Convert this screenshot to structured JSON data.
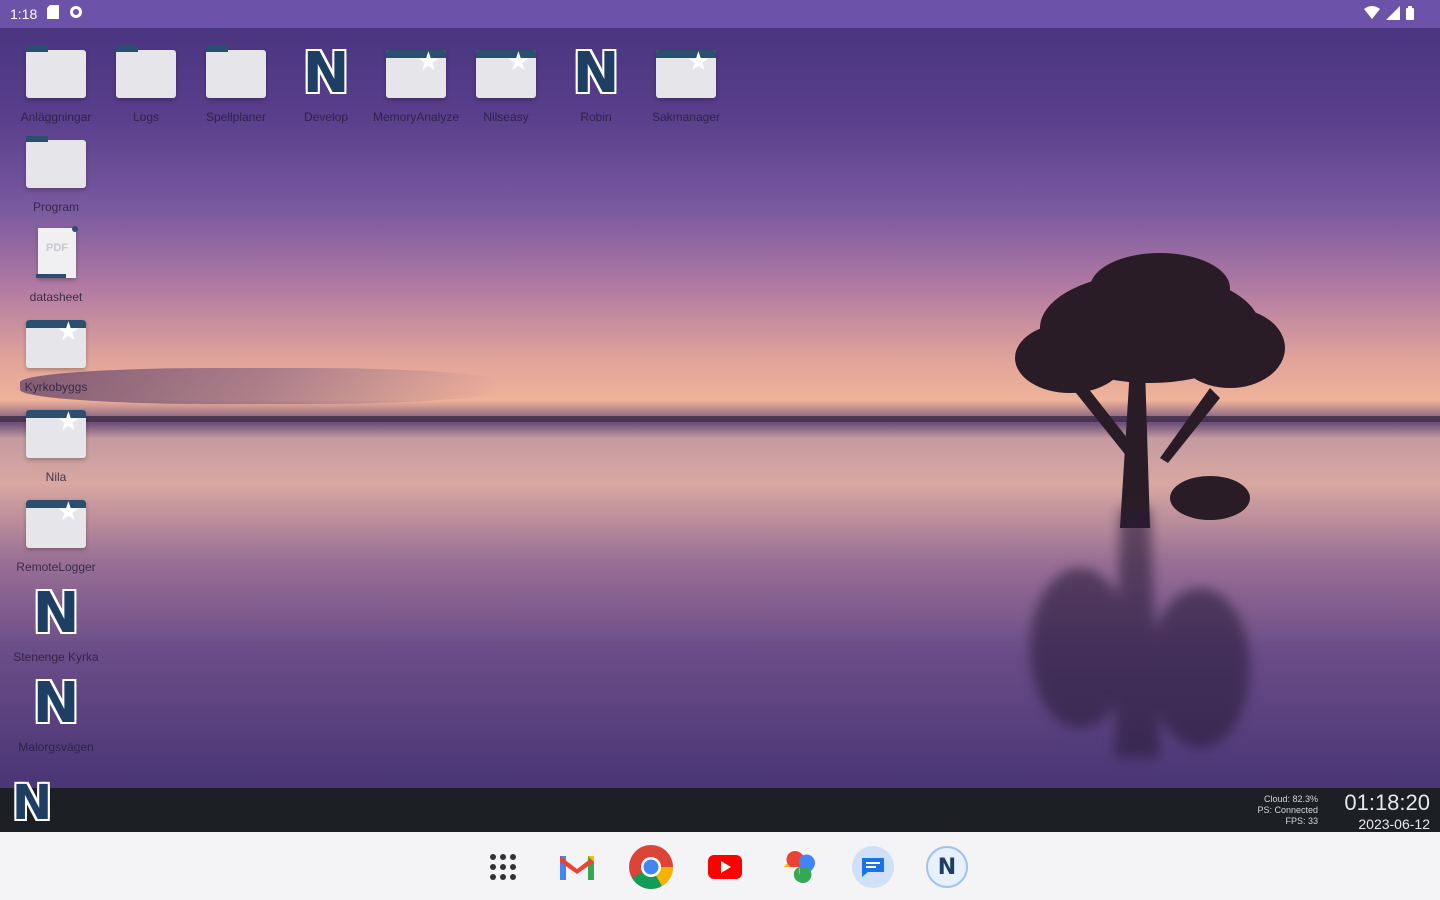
{
  "status_bar": {
    "time": "1:18"
  },
  "desktop": {
    "icons": [
      {
        "label": "Anläggningar",
        "type": "folder"
      },
      {
        "label": "Logs",
        "type": "folder"
      },
      {
        "label": "Spellplaner",
        "type": "folder"
      },
      {
        "label": "Develop",
        "type": "n-app"
      },
      {
        "label": "MemoryAnalyze",
        "type": "star-folder"
      },
      {
        "label": "Nilseasy",
        "type": "star-folder"
      },
      {
        "label": "Robin",
        "type": "n-app"
      },
      {
        "label": "Sakmanager",
        "type": "star-folder"
      },
      {
        "label": "Program",
        "type": "folder"
      },
      {
        "label": "datasheet",
        "type": "pdf"
      },
      {
        "label": "Kyrkobyggs",
        "type": "star-folder"
      },
      {
        "label": "Nila",
        "type": "star-folder"
      },
      {
        "label": "RemoteLogger",
        "type": "star-folder"
      },
      {
        "label": "Stenenge Kyrka",
        "type": "n-app"
      },
      {
        "label": "Malorgsvägen",
        "type": "n-app"
      }
    ]
  },
  "taskbar": {
    "info_lines": [
      "Cloud: 82.3%",
      "PS: Connected",
      "FPS: 33"
    ],
    "clock_time": "01:18:20",
    "clock_date": "2023-06-12"
  },
  "dock": {
    "apps": [
      "app-drawer",
      "gmail",
      "chrome",
      "youtube",
      "photos",
      "messages",
      "n-app"
    ]
  },
  "colors": {
    "status_bar": "#6c52a8",
    "folder_accent": "#2b4f6e",
    "taskbar": "#1c1f24",
    "dock": "#f4f4f6"
  }
}
